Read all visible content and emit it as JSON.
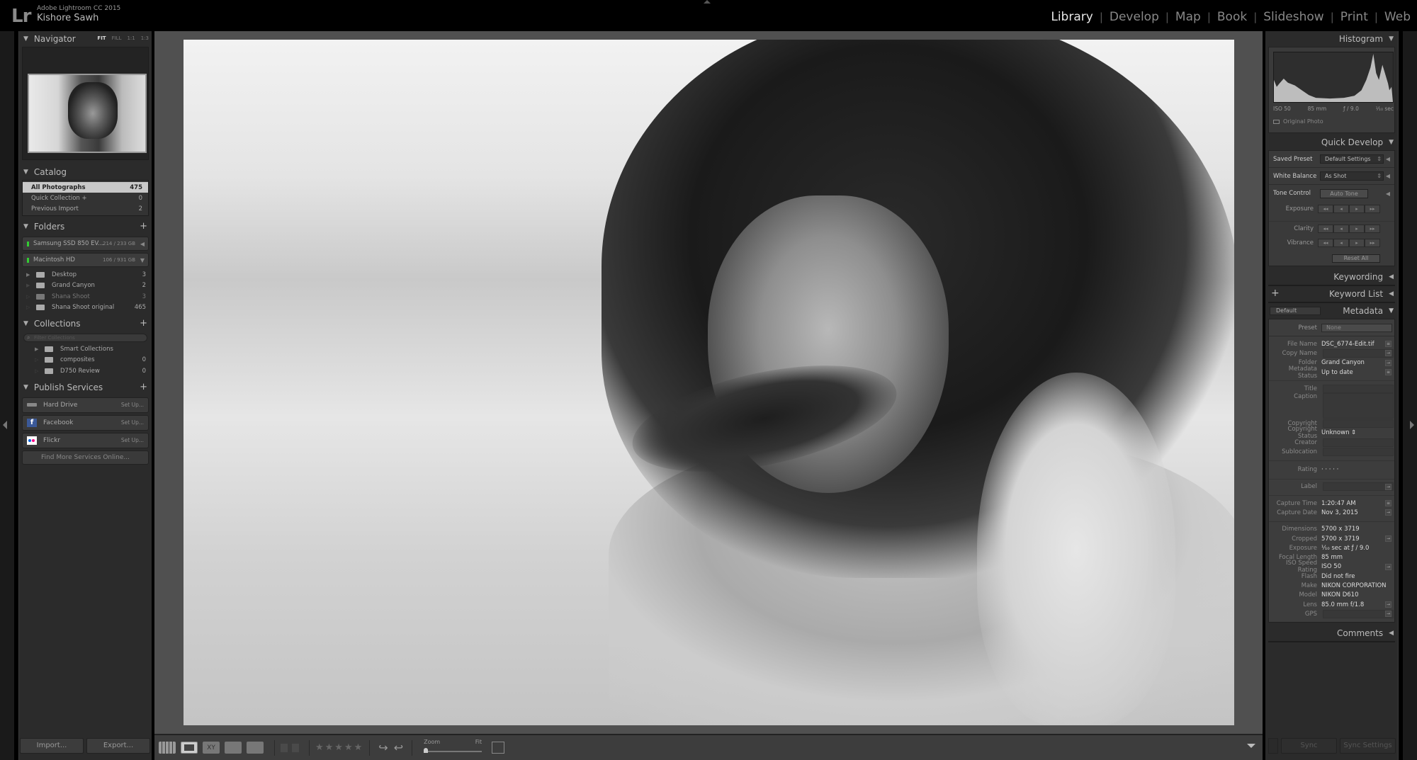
{
  "app": {
    "product": "Adobe Lightroom CC 2015",
    "user": "Kishore Sawh",
    "logo": "Lr"
  },
  "modules": [
    {
      "label": "Library",
      "active": true
    },
    {
      "label": "Develop",
      "active": false
    },
    {
      "label": "Map",
      "active": false
    },
    {
      "label": "Book",
      "active": false
    },
    {
      "label": "Slideshow",
      "active": false
    },
    {
      "label": "Print",
      "active": false
    },
    {
      "label": "Web",
      "active": false
    }
  ],
  "module_separator": "|",
  "navigator": {
    "title": "Navigator",
    "zoom_options": [
      "FIT",
      "FILL",
      "1:1",
      "1:3"
    ],
    "active_zoom": "FIT"
  },
  "catalog": {
    "title": "Catalog",
    "items": [
      {
        "label": "All Photographs",
        "count": "475",
        "selected": true
      },
      {
        "label": "Quick Collection +",
        "count": "0",
        "selected": false
      },
      {
        "label": "Previous Import",
        "count": "2",
        "selected": false
      }
    ]
  },
  "folders": {
    "title": "Folders",
    "add": "+",
    "volumes": [
      {
        "name": "Samsung SSD 850 EV...",
        "size": "214 / 233 GB",
        "arrow": "◀"
      },
      {
        "name": "Macintosh HD",
        "size": "106 / 931 GB",
        "arrow": "▼"
      }
    ],
    "items": [
      {
        "label": "Desktop",
        "count": "3",
        "dim": false
      },
      {
        "label": "Grand Canyon",
        "count": "2",
        "dim": false
      },
      {
        "label": "Shana Shoot",
        "count": "3",
        "dim": true
      },
      {
        "label": "Shana Shoot original",
        "count": "465",
        "dim": false
      }
    ]
  },
  "collections": {
    "title": "Collections",
    "add": "+",
    "filter_placeholder": "Filter Collections",
    "items": [
      {
        "label": "Smart Collections",
        "count": ""
      },
      {
        "label": "composites",
        "count": "0"
      },
      {
        "label": "D750 Review",
        "count": "0"
      }
    ]
  },
  "publish": {
    "title": "Publish Services",
    "add": "+",
    "services": [
      {
        "label": "Hard Drive",
        "action": "Set Up..."
      },
      {
        "label": "Facebook",
        "action": "Set Up..."
      },
      {
        "label": "Flickr",
        "action": "Set Up..."
      }
    ],
    "find_more": "Find More Services Online..."
  },
  "left_buttons": {
    "import": "Import...",
    "export": "Export..."
  },
  "toolbar": {
    "compare_label": "XY",
    "stars": "★★★★★",
    "rating": 0,
    "zoom_label": "Zoom",
    "zoom_value": "Fit"
  },
  "histogram": {
    "title": "Histogram",
    "iso": "ISO 50",
    "focal": "85 mm",
    "aperture": "ƒ / 9.0",
    "shutter": "¹⁄₁₀ sec",
    "original_photo": "Original Photo"
  },
  "quick_develop": {
    "title": "Quick Develop",
    "saved_preset_label": "Saved Preset",
    "saved_preset_value": "Default Settings",
    "white_balance_label": "White Balance",
    "white_balance_value": "As Shot",
    "tone_control_label": "Tone Control",
    "auto_tone": "Auto Tone",
    "adjustments": [
      "Exposure",
      "Clarity",
      "Vibrance"
    ],
    "reset_all": "Reset All"
  },
  "keywording": {
    "title": "Keywording"
  },
  "keyword_list": {
    "title": "Keyword List",
    "add": "+"
  },
  "metadata": {
    "title": "Metadata",
    "view": "Default",
    "preset_label": "Preset",
    "preset_value": "None",
    "fields": {
      "file_name": {
        "k": "File Name",
        "v": "DSC_6774-Edit.tif"
      },
      "copy_name": {
        "k": "Copy Name",
        "v": ""
      },
      "folder": {
        "k": "Folder",
        "v": "Grand Canyon"
      },
      "metadata_status": {
        "k": "Metadata Status",
        "v": "Up to date"
      },
      "title": {
        "k": "Title",
        "v": ""
      },
      "caption": {
        "k": "Caption",
        "v": ""
      },
      "copyright": {
        "k": "Copyright",
        "v": ""
      },
      "copyright_status": {
        "k": "Copyright Status",
        "v": "Unknown ⇕"
      },
      "creator": {
        "k": "Creator",
        "v": ""
      },
      "sublocation": {
        "k": "Sublocation",
        "v": ""
      },
      "rating": {
        "k": "Rating",
        "v": "·  ·  ·  ·  ·"
      },
      "label": {
        "k": "Label",
        "v": ""
      },
      "capture_time": {
        "k": "Capture Time",
        "v": "1:20:47 AM"
      },
      "capture_date": {
        "k": "Capture Date",
        "v": "Nov 3, 2015"
      },
      "dimensions": {
        "k": "Dimensions",
        "v": "5700 x 3719"
      },
      "cropped": {
        "k": "Cropped",
        "v": "5700 x 3719"
      },
      "exposure": {
        "k": "Exposure",
        "v": "¹⁄₁₀ sec at ƒ / 9.0"
      },
      "focal_length": {
        "k": "Focal Length",
        "v": "85 mm"
      },
      "iso": {
        "k": "ISO Speed Rating",
        "v": "ISO 50"
      },
      "flash": {
        "k": "Flash",
        "v": "Did not fire"
      },
      "make": {
        "k": "Make",
        "v": "NIKON CORPORATION"
      },
      "model": {
        "k": "Model",
        "v": "NIKON D610"
      },
      "lens": {
        "k": "Lens",
        "v": "85.0 mm f/1.8"
      },
      "gps": {
        "k": "GPS",
        "v": ""
      }
    }
  },
  "comments": {
    "title": "Comments"
  },
  "right_buttons": {
    "sync": "Sync",
    "sync_settings": "Sync Settings"
  }
}
